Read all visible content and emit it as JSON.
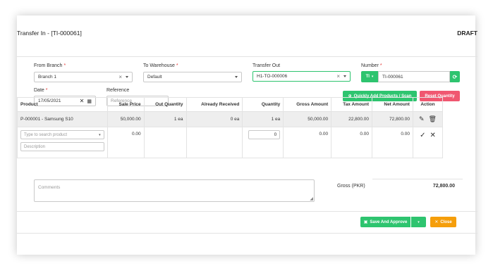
{
  "header": {
    "title": "Transfer In - [TI-000061]",
    "status": "DRAFT"
  },
  "form": {
    "from_branch": {
      "label": "From Branch",
      "value": "Branch 1"
    },
    "to_warehouse": {
      "label": "To Warehouse",
      "value": "Default"
    },
    "transfer_out": {
      "label": "Transfer Out",
      "value": "H1-TO-000006"
    },
    "number": {
      "label": "Number",
      "prefix": "TI",
      "value": "TI-000061"
    },
    "date": {
      "label": "Date",
      "value": "17/05/2021"
    },
    "reference": {
      "label": "Reference",
      "placeholder": "Reference"
    }
  },
  "actions": {
    "quick_add_label": "Quickly Add Products / Scan",
    "reset_quantity_label": "Reset Quantity"
  },
  "table": {
    "columns": [
      "Product",
      "Sale Price",
      "Out Quantity",
      "Already Received",
      "Quantity",
      "Gross Amount",
      "Tax Amount",
      "Net Amount",
      "Action"
    ],
    "rows": [
      {
        "product": "P-000001 - Samsung S10",
        "sale_price": "50,000.00",
        "out_quantity": "1 ea",
        "already_received": "0 ea",
        "quantity": "1 ea",
        "gross_amount": "50,000.00",
        "tax_amount": "22,800.00",
        "net_amount": "72,800.00"
      }
    ],
    "entry": {
      "search_placeholder": "Type to search product",
      "description_placeholder": "Description",
      "sale_price": "0.00",
      "quantity": "0",
      "gross_amount": "0.00",
      "tax_amount": "0.00",
      "net_amount": "0.00"
    }
  },
  "footer": {
    "comments_placeholder": "Comments",
    "gross_label": "Gross (PKR)",
    "gross_value": "72,800.00",
    "save_label": "Save And Approve",
    "close_label": "Close"
  },
  "colors": {
    "accent_green": "#2ec46f",
    "reset_red": "#f05770",
    "close_orange": "#f59e0b"
  }
}
